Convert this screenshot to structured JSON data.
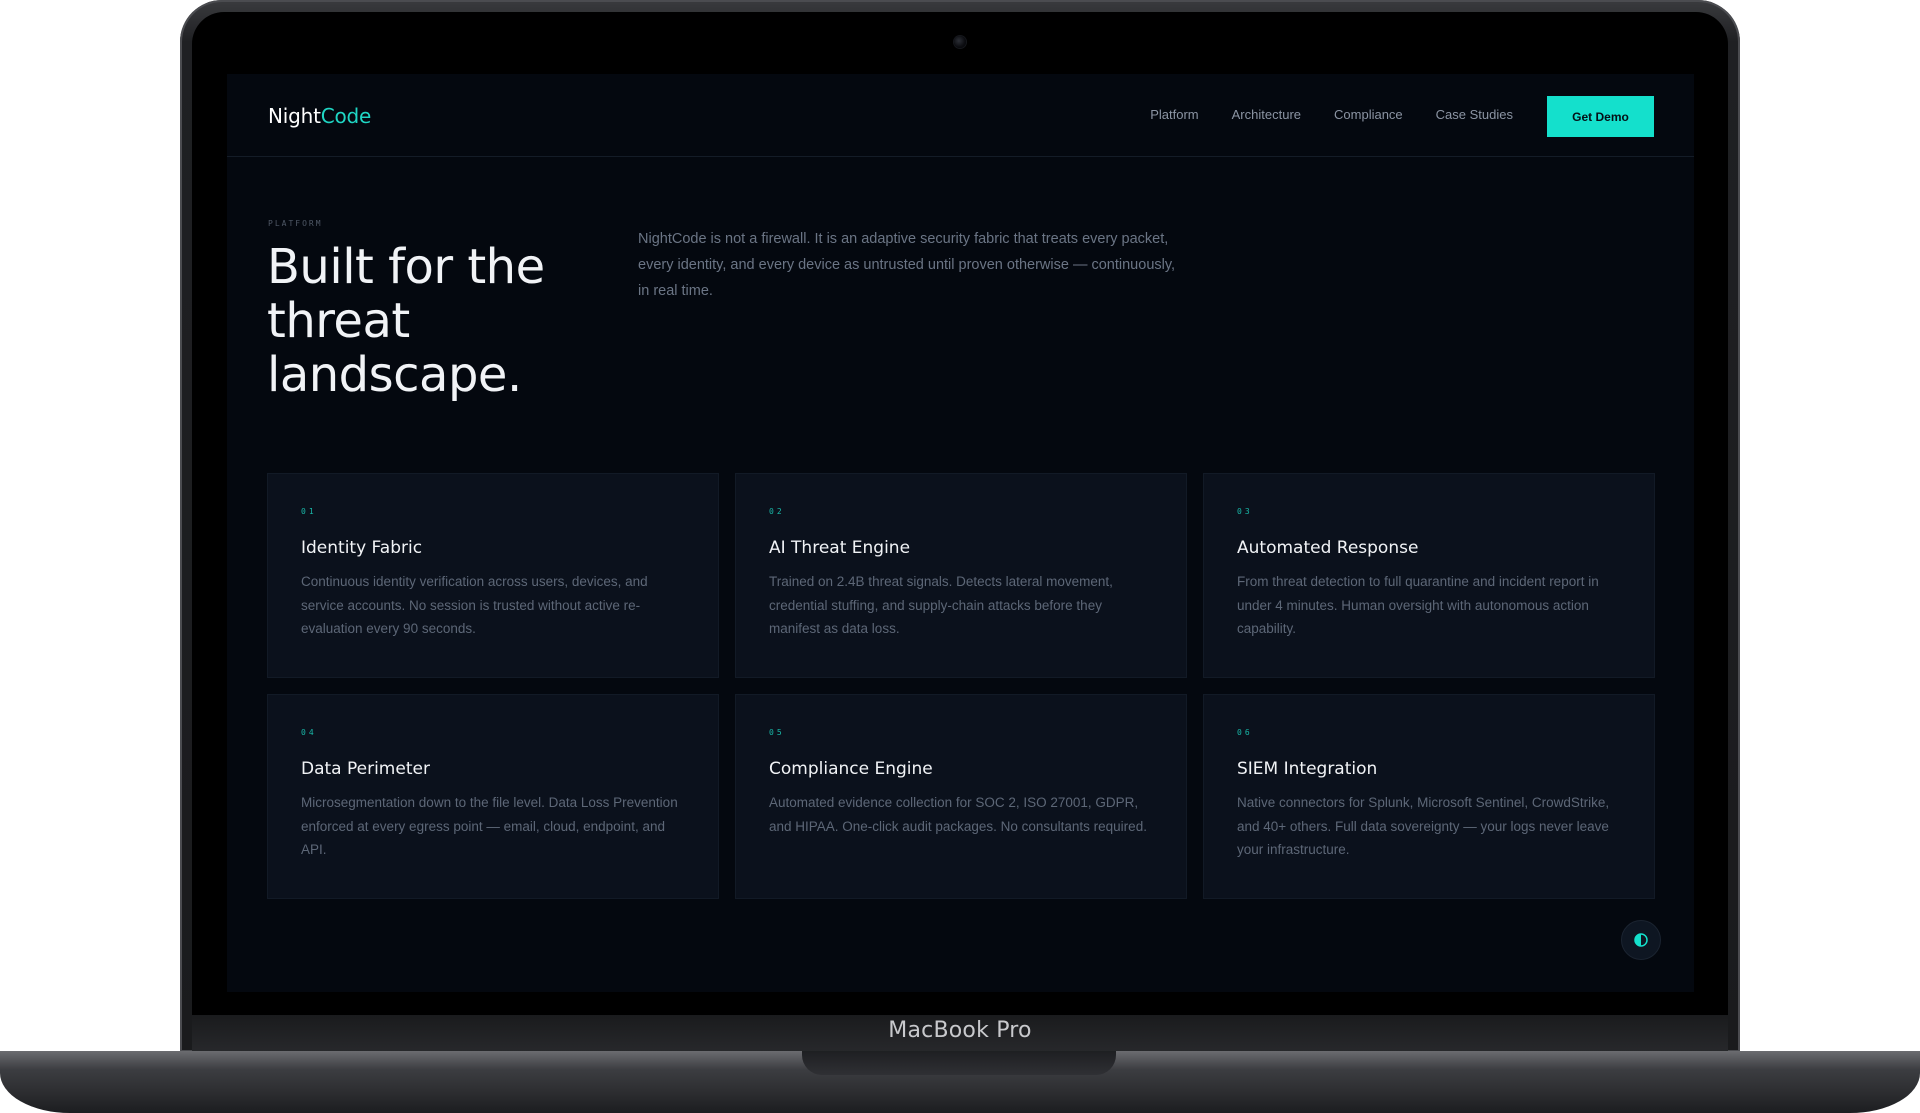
{
  "device": {
    "label": "MacBook Pro"
  },
  "brand": {
    "name_primary": "Night",
    "name_accent": "Code",
    "accent_color": "#1fd6c4"
  },
  "nav": {
    "links": [
      "Platform",
      "Architecture",
      "Compliance",
      "Case Studies"
    ],
    "cta_label": "Get Demo",
    "cta_color": "#14e0cc"
  },
  "hero": {
    "eyebrow": "PLATFORM",
    "title": "Built for the threat landscape.",
    "intro": "NightCode is not a firewall. It is an adaptive security fabric that treats every packet, every identity, and every device as untrusted until proven otherwise — continuously, in real time."
  },
  "features": [
    {
      "num": "01",
      "title": "Identity Fabric",
      "desc": "Continuous identity verification across users, devices, and service accounts. No session is trusted without active re-evaluation every 90 seconds."
    },
    {
      "num": "02",
      "title": "AI Threat Engine",
      "desc": "Trained on 2.4B threat signals. Detects lateral movement, credential stuffing, and supply-chain attacks before they manifest as data loss."
    },
    {
      "num": "03",
      "title": "Automated Response",
      "desc": "From threat detection to full quarantine and incident report in under 4 minutes. Human oversight with autonomous action capability."
    },
    {
      "num": "04",
      "title": "Data Perimeter",
      "desc": "Microsegmentation down to the file level. Data Loss Prevention enforced at every egress point — email, cloud, endpoint, and API."
    },
    {
      "num": "05",
      "title": "Compliance Engine",
      "desc": "Automated evidence collection for SOC 2, ISO 27001, GDPR, and HIPAA. One-click audit packages. No consultants required."
    },
    {
      "num": "06",
      "title": "SIEM Integration",
      "desc": "Native connectors for Splunk, Microsoft Sentinel, CrowdStrike, and 40+ others. Full data sovereignty — your logs never leave your infrastructure."
    }
  ],
  "theme_toggle": {
    "icon": "half-circle-contrast-icon"
  },
  "colors": {
    "page_bg": "#04080f",
    "card_bg": "#0b111c",
    "accent": "#14e0cc"
  }
}
